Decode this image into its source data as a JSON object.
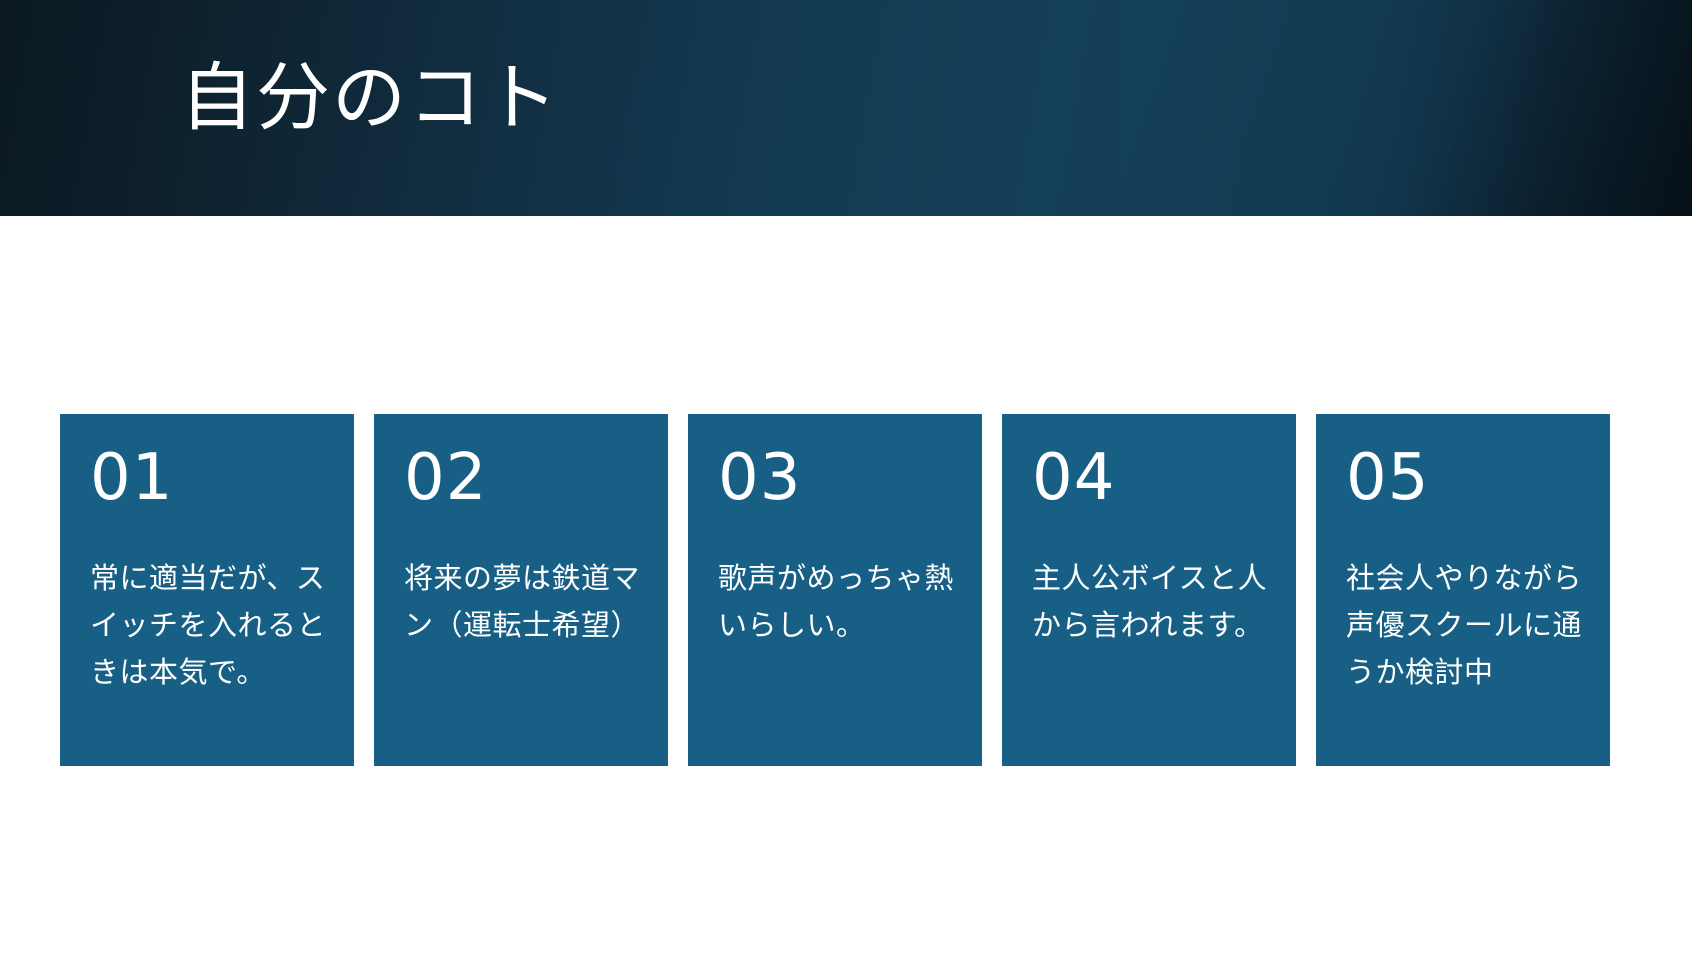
{
  "header": {
    "title": "自分のコト"
  },
  "cards": [
    {
      "number": "01",
      "text": "常に適当だが、スイッチを入れるときは本気で。"
    },
    {
      "number": "02",
      "text": "将来の夢は鉄道マン（運転士希望）"
    },
    {
      "number": "03",
      "text": "歌声がめっちゃ熱いらしい。"
    },
    {
      "number": "04",
      "text": "主人公ボイスと人から言われます。"
    },
    {
      "number": "05",
      "text": "社会人やりながら声優スクールに通うか検討中"
    }
  ],
  "colors": {
    "header_dark": "#0b1820",
    "header_mid": "#143f59",
    "card_background": "#185f86",
    "text": "#ffffff",
    "page_background": "#ffffff"
  }
}
